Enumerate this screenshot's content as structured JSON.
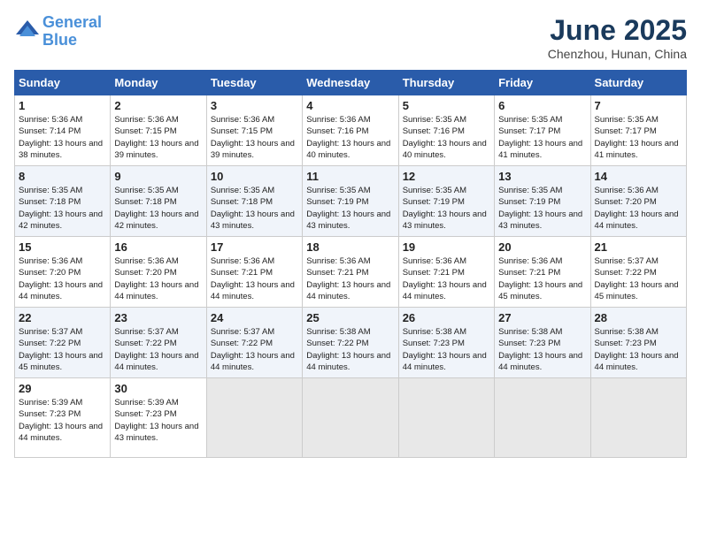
{
  "header": {
    "logo_line1": "General",
    "logo_line2": "Blue",
    "month": "June 2025",
    "location": "Chenzhou, Hunan, China"
  },
  "weekdays": [
    "Sunday",
    "Monday",
    "Tuesday",
    "Wednesday",
    "Thursday",
    "Friday",
    "Saturday"
  ],
  "weeks": [
    [
      {
        "day": 1,
        "sunrise": "5:36 AM",
        "sunset": "7:14 PM",
        "daylight": "13 hours and 38 minutes."
      },
      {
        "day": 2,
        "sunrise": "5:36 AM",
        "sunset": "7:15 PM",
        "daylight": "13 hours and 39 minutes."
      },
      {
        "day": 3,
        "sunrise": "5:36 AM",
        "sunset": "7:15 PM",
        "daylight": "13 hours and 39 minutes."
      },
      {
        "day": 4,
        "sunrise": "5:36 AM",
        "sunset": "7:16 PM",
        "daylight": "13 hours and 40 minutes."
      },
      {
        "day": 5,
        "sunrise": "5:35 AM",
        "sunset": "7:16 PM",
        "daylight": "13 hours and 40 minutes."
      },
      {
        "day": 6,
        "sunrise": "5:35 AM",
        "sunset": "7:17 PM",
        "daylight": "13 hours and 41 minutes."
      },
      {
        "day": 7,
        "sunrise": "5:35 AM",
        "sunset": "7:17 PM",
        "daylight": "13 hours and 41 minutes."
      }
    ],
    [
      {
        "day": 8,
        "sunrise": "5:35 AM",
        "sunset": "7:18 PM",
        "daylight": "13 hours and 42 minutes."
      },
      {
        "day": 9,
        "sunrise": "5:35 AM",
        "sunset": "7:18 PM",
        "daylight": "13 hours and 42 minutes."
      },
      {
        "day": 10,
        "sunrise": "5:35 AM",
        "sunset": "7:18 PM",
        "daylight": "13 hours and 43 minutes."
      },
      {
        "day": 11,
        "sunrise": "5:35 AM",
        "sunset": "7:19 PM",
        "daylight": "13 hours and 43 minutes."
      },
      {
        "day": 12,
        "sunrise": "5:35 AM",
        "sunset": "7:19 PM",
        "daylight": "13 hours and 43 minutes."
      },
      {
        "day": 13,
        "sunrise": "5:35 AM",
        "sunset": "7:19 PM",
        "daylight": "13 hours and 43 minutes."
      },
      {
        "day": 14,
        "sunrise": "5:36 AM",
        "sunset": "7:20 PM",
        "daylight": "13 hours and 44 minutes."
      }
    ],
    [
      {
        "day": 15,
        "sunrise": "5:36 AM",
        "sunset": "7:20 PM",
        "daylight": "13 hours and 44 minutes."
      },
      {
        "day": 16,
        "sunrise": "5:36 AM",
        "sunset": "7:20 PM",
        "daylight": "13 hours and 44 minutes."
      },
      {
        "day": 17,
        "sunrise": "5:36 AM",
        "sunset": "7:21 PM",
        "daylight": "13 hours and 44 minutes."
      },
      {
        "day": 18,
        "sunrise": "5:36 AM",
        "sunset": "7:21 PM",
        "daylight": "13 hours and 44 minutes."
      },
      {
        "day": 19,
        "sunrise": "5:36 AM",
        "sunset": "7:21 PM",
        "daylight": "13 hours and 44 minutes."
      },
      {
        "day": 20,
        "sunrise": "5:36 AM",
        "sunset": "7:21 PM",
        "daylight": "13 hours and 45 minutes."
      },
      {
        "day": 21,
        "sunrise": "5:37 AM",
        "sunset": "7:22 PM",
        "daylight": "13 hours and 45 minutes."
      }
    ],
    [
      {
        "day": 22,
        "sunrise": "5:37 AM",
        "sunset": "7:22 PM",
        "daylight": "13 hours and 45 minutes."
      },
      {
        "day": 23,
        "sunrise": "5:37 AM",
        "sunset": "7:22 PM",
        "daylight": "13 hours and 44 minutes."
      },
      {
        "day": 24,
        "sunrise": "5:37 AM",
        "sunset": "7:22 PM",
        "daylight": "13 hours and 44 minutes."
      },
      {
        "day": 25,
        "sunrise": "5:38 AM",
        "sunset": "7:22 PM",
        "daylight": "13 hours and 44 minutes."
      },
      {
        "day": 26,
        "sunrise": "5:38 AM",
        "sunset": "7:23 PM",
        "daylight": "13 hours and 44 minutes."
      },
      {
        "day": 27,
        "sunrise": "5:38 AM",
        "sunset": "7:23 PM",
        "daylight": "13 hours and 44 minutes."
      },
      {
        "day": 28,
        "sunrise": "5:38 AM",
        "sunset": "7:23 PM",
        "daylight": "13 hours and 44 minutes."
      }
    ],
    [
      {
        "day": 29,
        "sunrise": "5:39 AM",
        "sunset": "7:23 PM",
        "daylight": "13 hours and 44 minutes."
      },
      {
        "day": 30,
        "sunrise": "5:39 AM",
        "sunset": "7:23 PM",
        "daylight": "13 hours and 43 minutes."
      },
      null,
      null,
      null,
      null,
      null
    ]
  ]
}
